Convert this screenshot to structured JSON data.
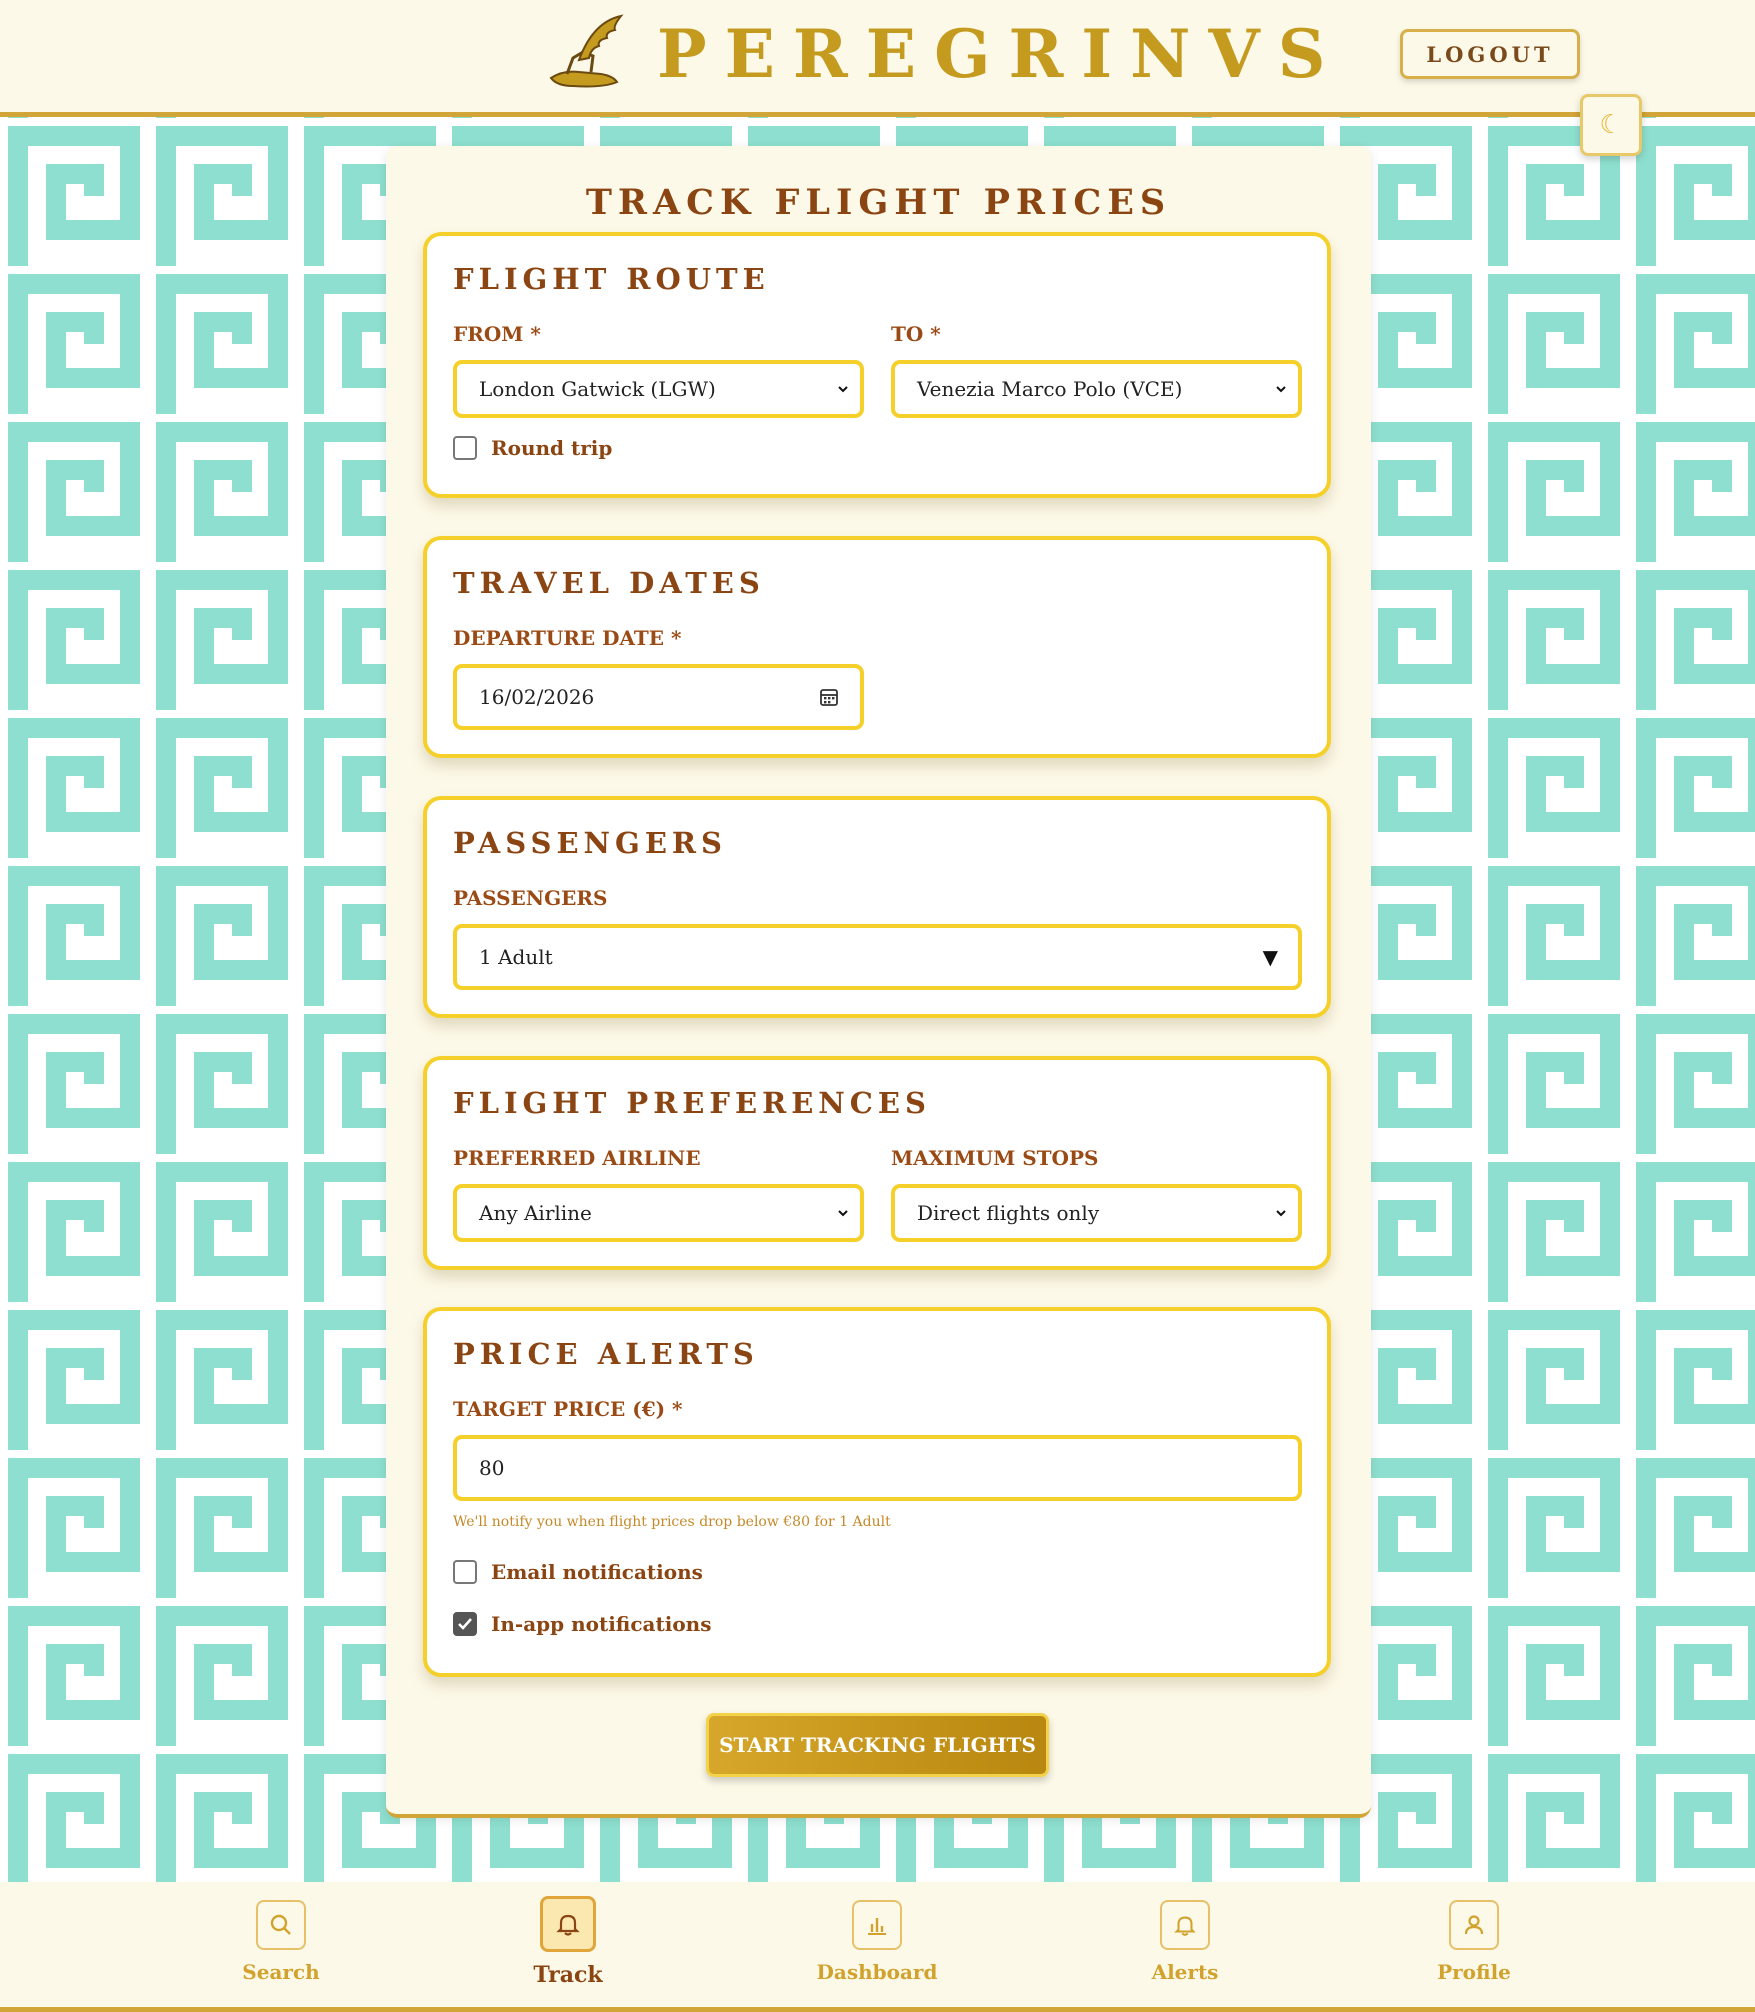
{
  "header": {
    "brand": "PEREGRINVS",
    "logout_label": "LOGOUT",
    "theme_icon": "moon-icon"
  },
  "page": {
    "title": "TRACK FLIGHT PRICES"
  },
  "route": {
    "title": "FLIGHT ROUTE",
    "from_label": "FROM *",
    "from_value": "London Gatwick (LGW)",
    "to_label": "TO *",
    "to_value": "Venezia Marco Polo (VCE)",
    "round_trip_label": "Round trip",
    "round_trip_checked": false
  },
  "dates": {
    "title": "TRAVEL DATES",
    "departure_label": "DEPARTURE DATE *",
    "departure_value": "16/02/2026"
  },
  "passengers": {
    "title": "PASSENGERS",
    "label": "PASSENGERS",
    "value": "1 Adult"
  },
  "preferences": {
    "title": "FLIGHT PREFERENCES",
    "airline_label": "PREFERRED AIRLINE",
    "airline_value": "Any Airline",
    "stops_label": "MAXIMUM STOPS",
    "stops_value": "Direct flights only"
  },
  "alerts": {
    "title": "PRICE ALERTS",
    "target_label": "TARGET PRICE (€) *",
    "target_value": "80",
    "hint": "We'll notify you when flight prices drop below €80 for 1 Adult",
    "email_label": "Email notifications",
    "email_checked": false,
    "inapp_label": "In-app notifications",
    "inapp_checked": true
  },
  "start_button": "START TRACKING FLIGHTS",
  "nav": {
    "items": [
      {
        "label": "Search",
        "icon": "search-icon"
      },
      {
        "label": "Track",
        "icon": "bell-icon",
        "active": true
      },
      {
        "label": "Dashboard",
        "icon": "chart-icon"
      },
      {
        "label": "Alerts",
        "icon": "bell-icon"
      },
      {
        "label": "Profile",
        "icon": "user-icon"
      }
    ]
  },
  "colors": {
    "gold": "#c49a1f",
    "brown": "#8a4513",
    "field_border": "#f5d02a",
    "pattern": "#8edfcf",
    "cream": "#fdf9e8"
  }
}
